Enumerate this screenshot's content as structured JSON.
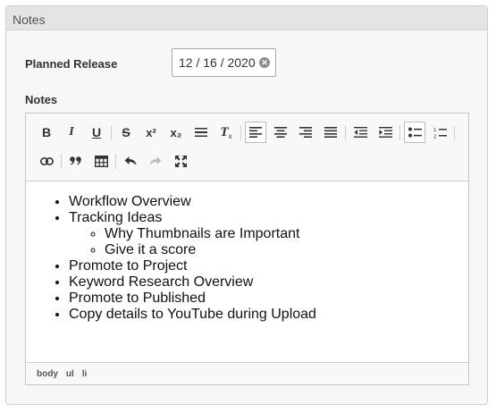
{
  "panel": {
    "title": "Notes"
  },
  "form": {
    "planned_release_label": "Planned Release",
    "planned_release_value": "12 / 16 / 2020",
    "notes_label": "Notes"
  },
  "toolbar": {
    "bold": "B",
    "italic": "I",
    "underline": "U",
    "strike": "S",
    "superscript": "x²",
    "subscript": "x₂",
    "clear_format": "T"
  },
  "editor": {
    "items": [
      "Workflow Overview",
      "Tracking Ideas",
      "Promote to Project",
      "Keyword Research Overview",
      "Promote to Published",
      "Copy details to YouTube during Upload"
    ],
    "sub_items": [
      "Why Thumbnails are Important",
      "Give it a score"
    ],
    "path": [
      "body",
      "ul",
      "li"
    ]
  }
}
